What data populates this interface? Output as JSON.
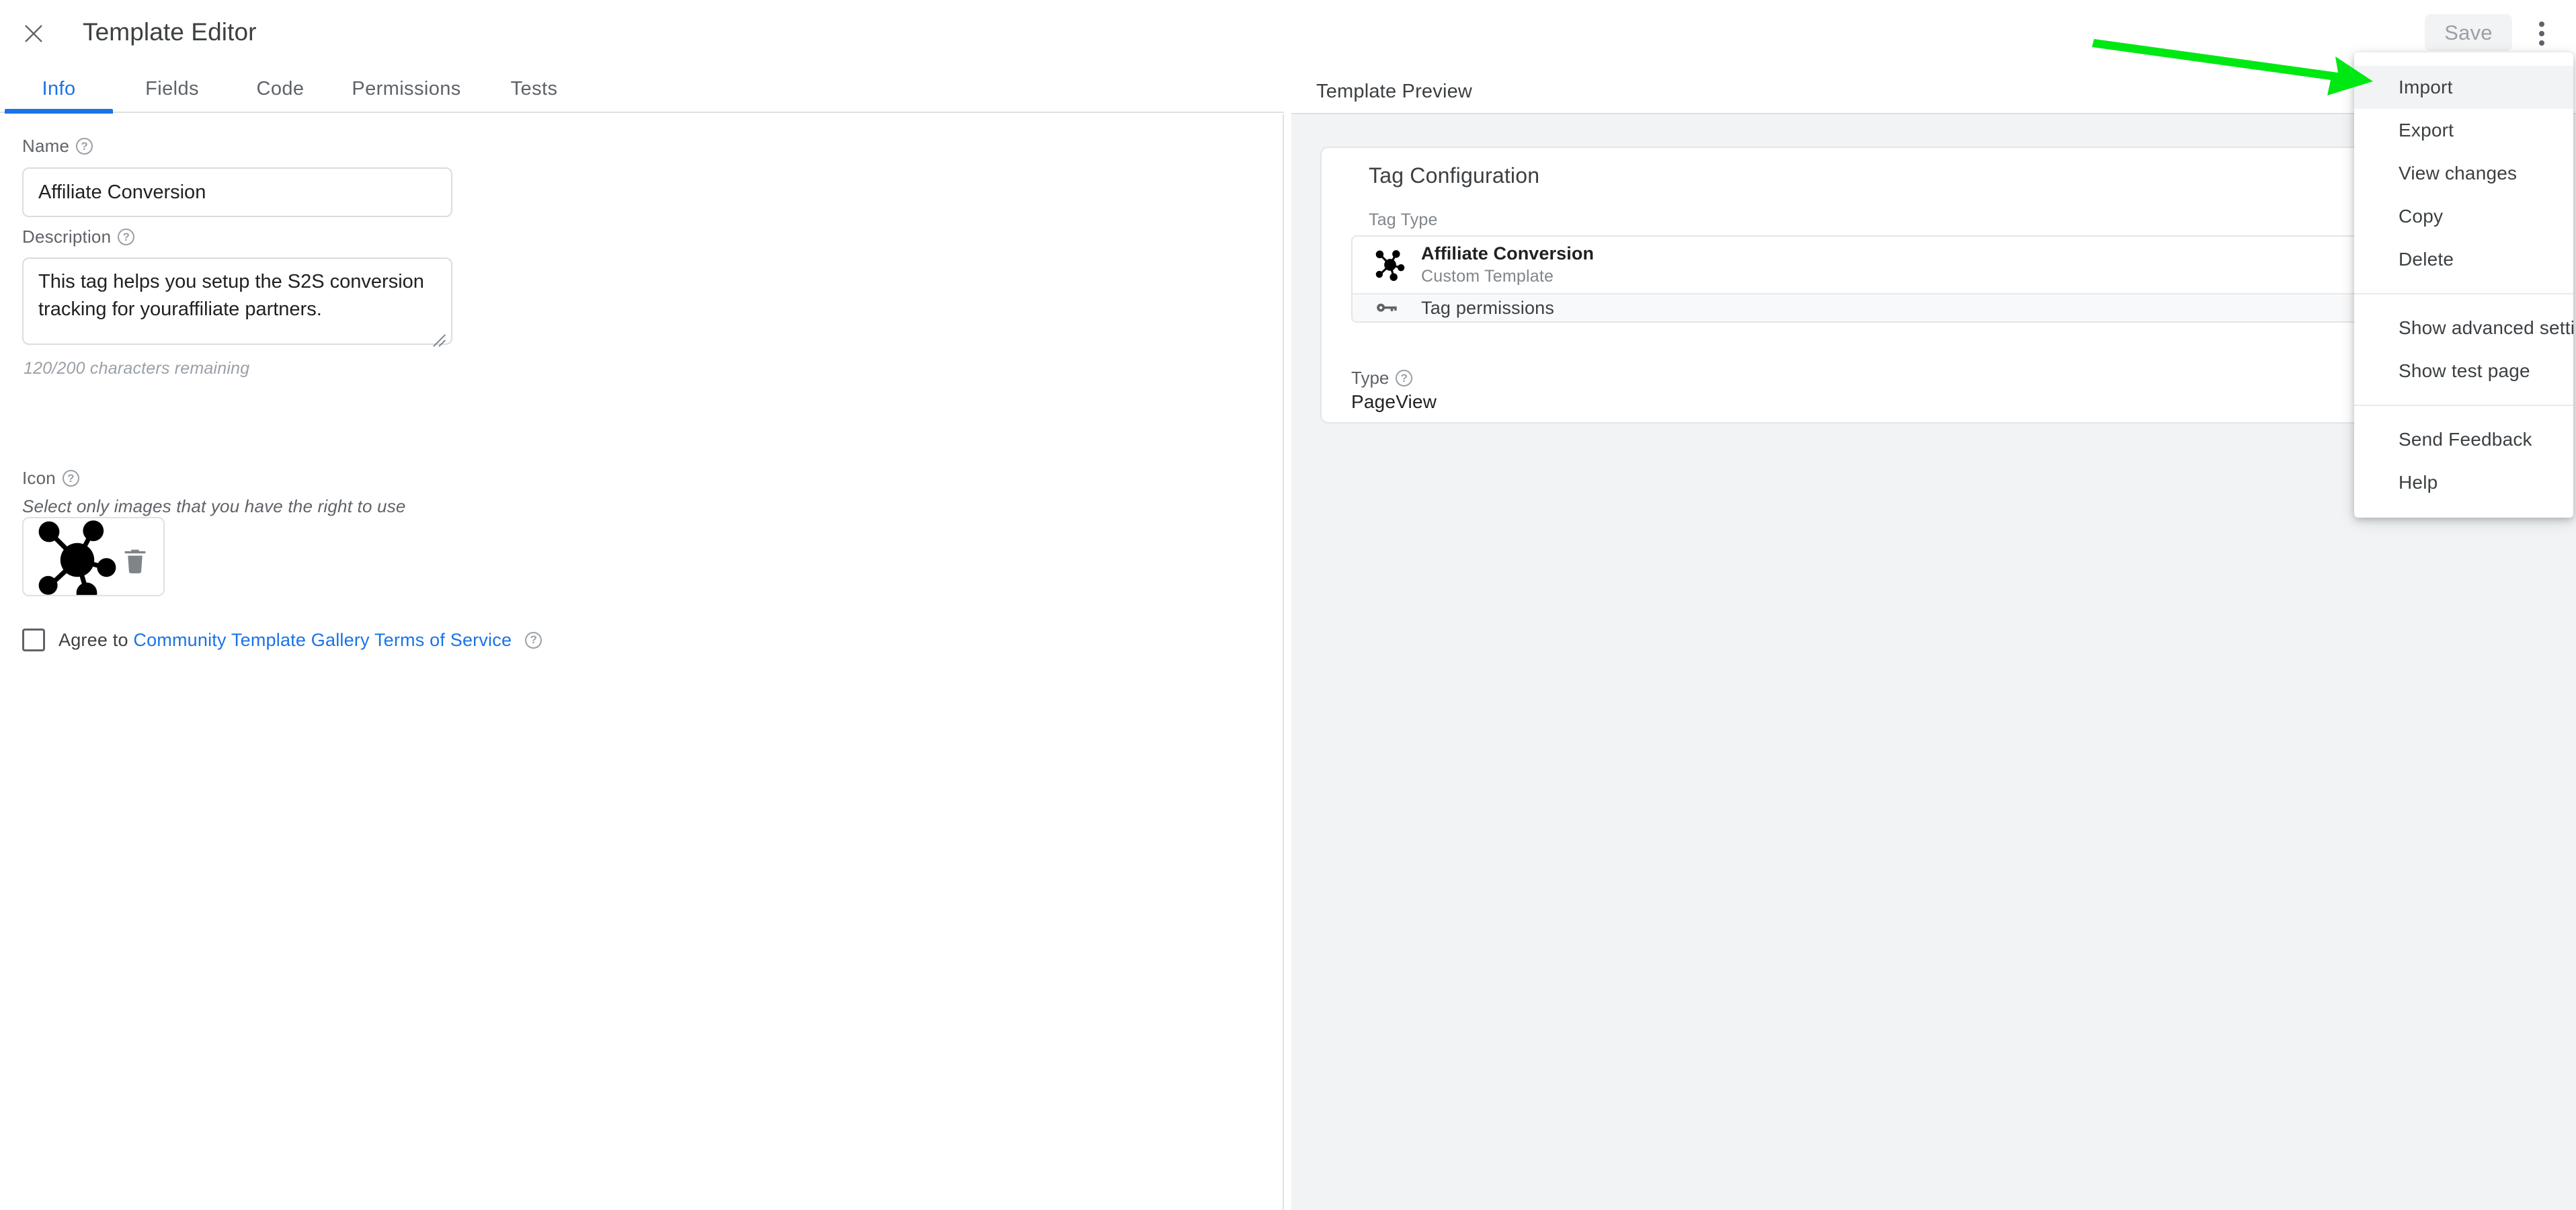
{
  "header": {
    "title": "Template Editor",
    "close_icon": "close-icon",
    "save_label": "Save",
    "overflow_icon": "more-vert-icon"
  },
  "tabs": [
    {
      "label": "Info",
      "active": true
    },
    {
      "label": "Fields",
      "active": false
    },
    {
      "label": "Code",
      "active": false
    },
    {
      "label": "Permissions",
      "active": false
    },
    {
      "label": "Tests",
      "active": false
    }
  ],
  "form": {
    "name": {
      "label": "Name",
      "value": "Affiliate Conversion",
      "placeholder": ""
    },
    "description": {
      "label": "Description",
      "value": "This tag helps you setup the S2S conversion tracking for youraffiliate partners.",
      "placeholder": "",
      "char_count": "120/200 characters remaining"
    },
    "icon": {
      "label": "Icon",
      "hint": "Select only images that you have the right to use",
      "preview_icon": "hub-network-icon",
      "delete_icon": "trash-icon"
    },
    "agree": {
      "prefix": "Agree to ",
      "link": "Community Template Gallery Terms of Service",
      "checked": false
    },
    "help_icon_glyph": "?"
  },
  "preview": {
    "header_title": "Template Preview",
    "card": {
      "title": "Tag Configuration",
      "tag_type_label": "Tag Type",
      "tag_type": {
        "name": "Affiliate Conversion",
        "subtitle": "Custom Template",
        "icon": "hub-network-icon"
      },
      "permissions": {
        "label": "Tag permissions",
        "icon": "key-icon"
      },
      "type_label": "Type",
      "type_value": "PageView"
    }
  },
  "menu": {
    "items": [
      {
        "label": "Import",
        "hovered": true,
        "separator_after": false
      },
      {
        "label": "Export",
        "hovered": false,
        "separator_after": false
      },
      {
        "label": "View changes",
        "hovered": false,
        "separator_after": false
      },
      {
        "label": "Copy",
        "hovered": false,
        "separator_after": false
      },
      {
        "label": "Delete",
        "hovered": false,
        "separator_after": true
      },
      {
        "label": "Show advanced settings",
        "hovered": false,
        "separator_after": false
      },
      {
        "label": "Show test page",
        "hovered": false,
        "separator_after": true
      },
      {
        "label": "Send Feedback",
        "hovered": false,
        "separator_after": false
      },
      {
        "label": "Help",
        "hovered": false,
        "separator_after": false
      }
    ]
  },
  "annotation": {
    "arrow_color": "#00e813",
    "points_to": "Import"
  },
  "colors": {
    "accent_blue": "#1a73e8",
    "panel_bg": "#f1f3f4",
    "text_primary": "#202124",
    "text_secondary": "#5f6368",
    "border": "#e0e0e0"
  }
}
